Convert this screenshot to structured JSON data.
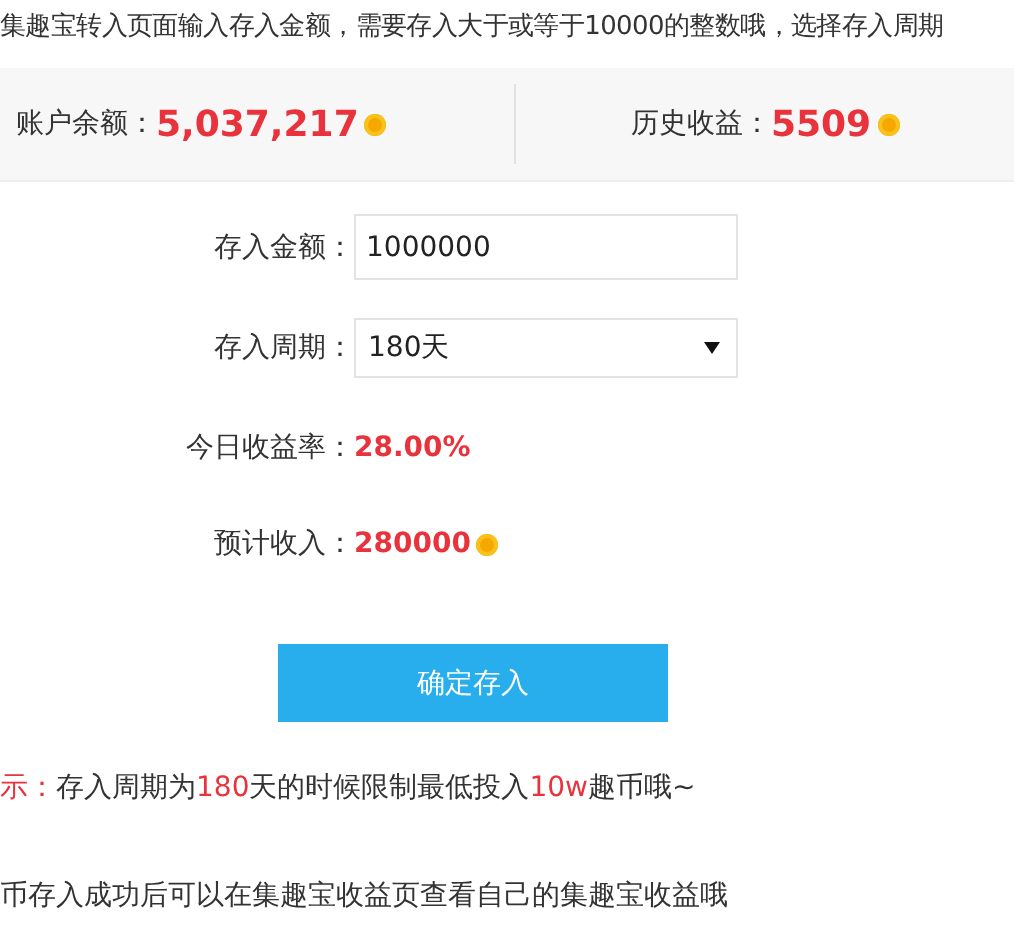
{
  "intro": "集趣宝转入页面输入存入金额，需要存入大于或等于10000的整数哦，选择存入周期",
  "stats": [
    {
      "label": "账户余额：",
      "value": "5,037,217"
    },
    {
      "label": "历史收益：",
      "value": "5509"
    }
  ],
  "form": {
    "amount_label": "存入金额：",
    "amount_value": "1000000",
    "period_label": "存入周期：",
    "period_value": "180天",
    "rate_label": "今日收益率：",
    "rate_value": "28.00%",
    "income_label": "预计收入：",
    "income_value": "280000"
  },
  "submit_button": "确定存入",
  "tip": [
    {
      "text": "示：",
      "highlight": true
    },
    {
      "text": "存入周期为",
      "highlight": false
    },
    {
      "text": "180",
      "highlight": true
    },
    {
      "text": "天的时候限制最低投入",
      "highlight": false
    },
    {
      "text": "10w",
      "highlight": true
    },
    {
      "text": "趣币哦~",
      "highlight": false
    }
  ],
  "footer_note": "币存入成功后可以在集趣宝收益页查看自己的集趣宝收益哦"
}
